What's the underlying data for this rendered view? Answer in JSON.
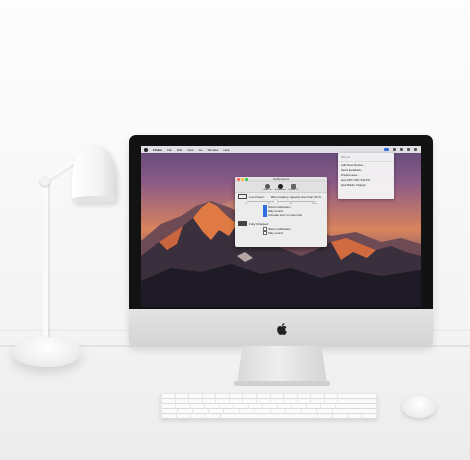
{
  "menubar": {
    "app_name": "Finder",
    "items": [
      "File",
      "Edit",
      "View",
      "Go",
      "Window",
      "Help"
    ]
  },
  "dropdown": {
    "header": "iPhone",
    "items": [
      "Add New Device...",
      "Send feedback...",
      "Preferences...",
      "Get 20% OFF SALTR",
      "Quit Battie Charge"
    ]
  },
  "window": {
    "title": "Notifications",
    "toolbar": [
      "About Us",
      "Notifications",
      "Update UX"
    ],
    "low_power_label": "Low Power:",
    "low_power_text": "When battery capacity less than 20 %",
    "slider_value_percent": 20,
    "ticks": [
      "10",
      "20",
      "30",
      "40 %"
    ],
    "low_checks": [
      {
        "label": "Show notification",
        "checked": true
      },
      {
        "label": "Play sound",
        "checked": true
      },
      {
        "label": "Animate icon in menu bar",
        "checked": true
      }
    ],
    "full_label": "Fully Charged:",
    "full_checks": [
      {
        "label": "Show notification",
        "checked": false
      },
      {
        "label": "Play sound",
        "checked": false
      }
    ]
  },
  "colors": {
    "accent": "#2d6de0",
    "bezel": "#121212",
    "aluminum": "#dcdcdc"
  }
}
